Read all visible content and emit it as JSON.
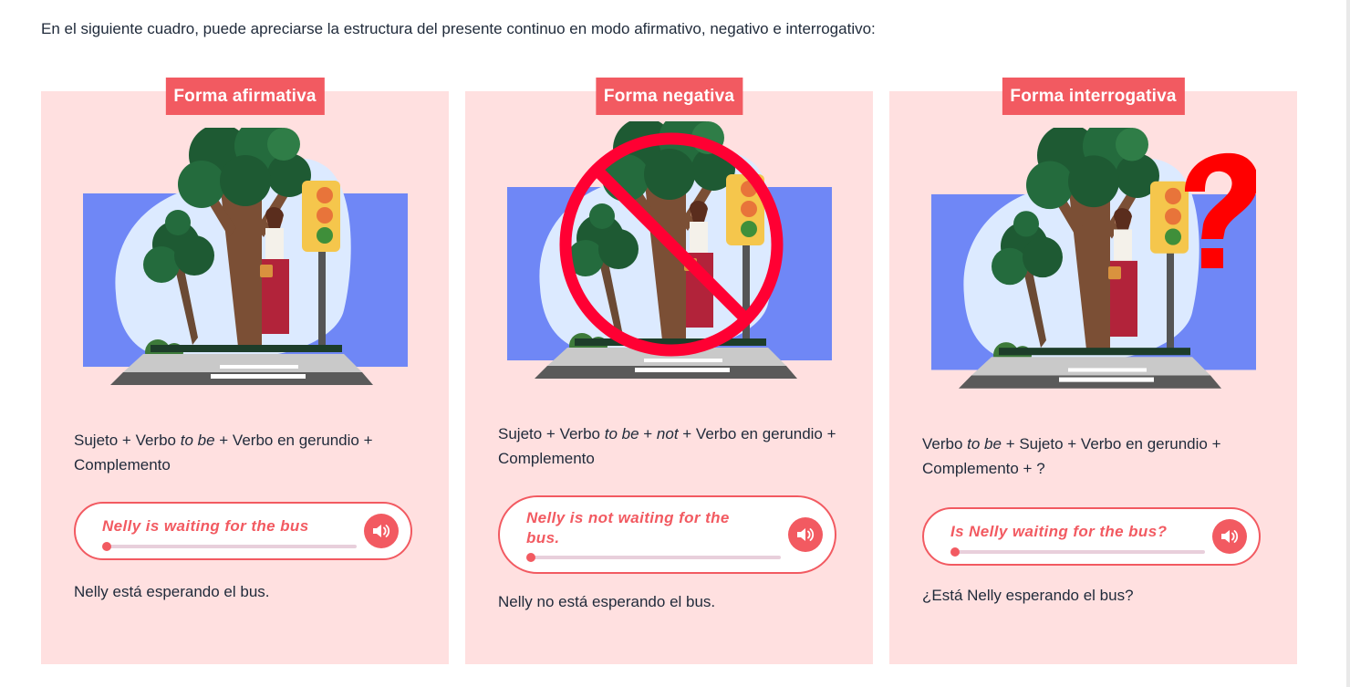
{
  "intro": "En el siguiente cuadro, puede apreciarse la estructura del presente continuo en modo afirmativo, negativo e interrogativo:",
  "cards": [
    {
      "title": "Forma afirmativa",
      "formula": [
        {
          "text": "Sujeto + Verbo ",
          "italic": false
        },
        {
          "text": "to be",
          "italic": true
        },
        {
          "text": " + Verbo en gerundio + Complemento",
          "italic": false
        }
      ],
      "example": "Nelly is waiting for the bus",
      "audio_icon": "speaker-icon",
      "translation": "Nelly está esperando el bus."
    },
    {
      "title": "Forma negativa",
      "formula": [
        {
          "text": "Sujeto + Verbo ",
          "italic": false
        },
        {
          "text": "to be",
          "italic": true
        },
        {
          "text": " + ",
          "italic": false
        },
        {
          "text": "not",
          "italic": true
        },
        {
          "text": " + Verbo en gerundio + Complemento",
          "italic": false
        }
      ],
      "example": "Nelly is not waiting for the bus.",
      "audio_icon": "speaker-icon",
      "translation": "Nelly no está esperando el bus."
    },
    {
      "title": "Forma interrogativa",
      "formula": [
        {
          "text": "Verbo ",
          "italic": false
        },
        {
          "text": "to be",
          "italic": true
        },
        {
          "text": " + Sujeto + Verbo en gerundio + Complemento + ?",
          "italic": false
        }
      ],
      "example": "Is Nelly waiting for the bus?",
      "audio_icon": "speaker-icon",
      "translation": "¿Está Nelly esperando el bus?"
    }
  ],
  "colors": {
    "card_background": "#ffe0e0",
    "accent": "#f25a61",
    "illustration_sky": "#6f87f6",
    "no_sign": "#ff0033",
    "question_mark": "#ff0000"
  }
}
